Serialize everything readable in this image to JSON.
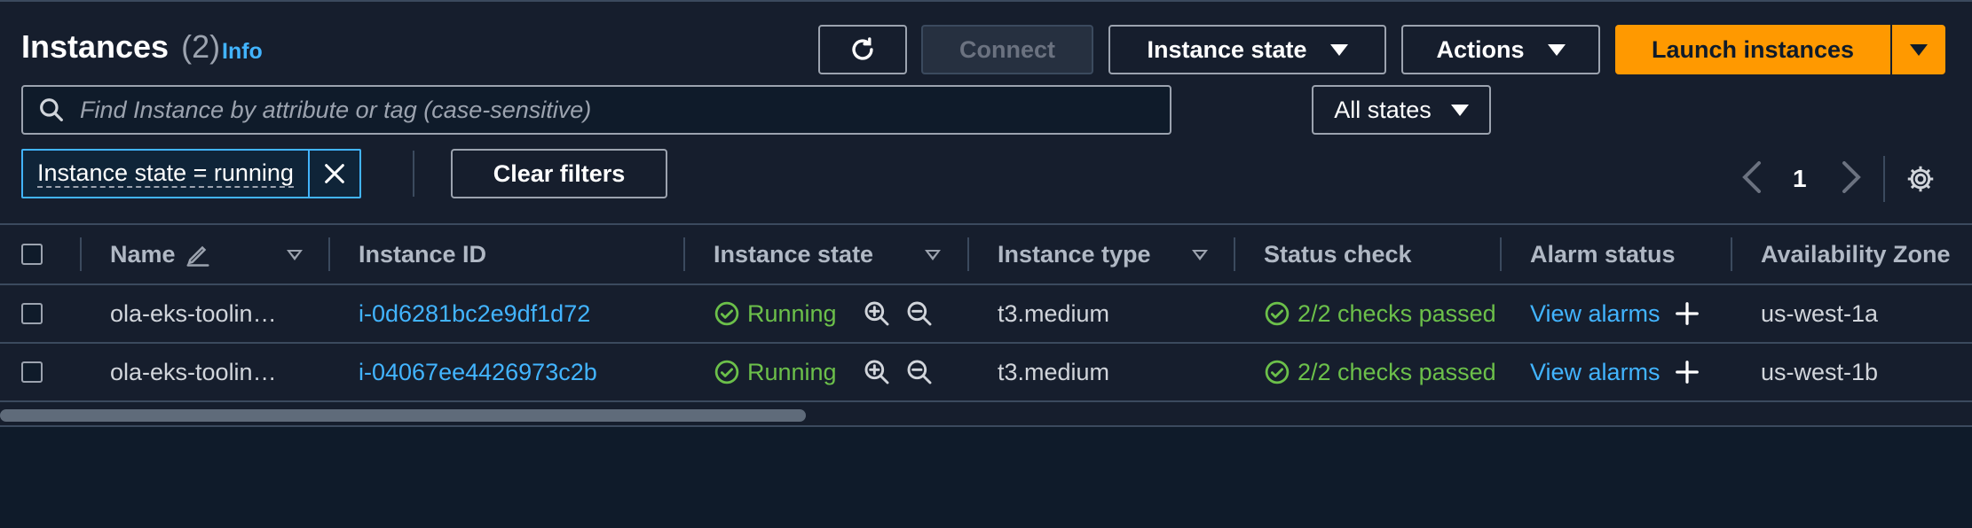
{
  "header": {
    "title": "Instances",
    "count": "(2)",
    "info_label": "Info"
  },
  "toolbar": {
    "refresh_icon": "refresh-icon",
    "connect_label": "Connect",
    "instance_state_label": "Instance state",
    "actions_label": "Actions",
    "launch_label": "Launch instances"
  },
  "search": {
    "placeholder": "Find Instance by attribute or tag (case-sensitive)",
    "value": ""
  },
  "states_filter": {
    "selected": "All states"
  },
  "filter_token": {
    "label": "Instance state = running"
  },
  "clear_filters_label": "Clear filters",
  "pagination": {
    "page": "1"
  },
  "table": {
    "columns": [
      "Name",
      "Instance ID",
      "Instance state",
      "Instance type",
      "Status check",
      "Alarm status",
      "Availability Zone"
    ],
    "rows": [
      {
        "name": "ola-eks-toolin…",
        "instance_id": "i-0d6281bc2e9df1d72",
        "state": "Running",
        "type": "t3.medium",
        "status_check": "2/2 checks passed",
        "alarm": "View alarms",
        "az": "us-west-1a"
      },
      {
        "name": "ola-eks-toolin…",
        "instance_id": "i-04067ee4426973c2b",
        "state": "Running",
        "type": "t3.medium",
        "status_check": "2/2 checks passed",
        "alarm": "View alarms",
        "az": "us-west-1b"
      }
    ]
  },
  "colors": {
    "accent": "#ff9900",
    "link": "#42b4ff",
    "success": "#6cc04a",
    "background": "#161e2d"
  }
}
